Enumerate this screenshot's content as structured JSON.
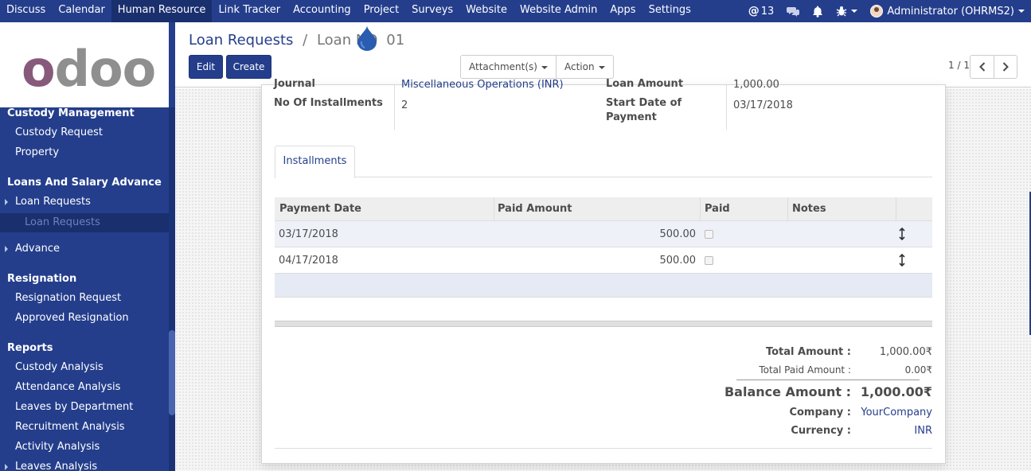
{
  "topbar": {
    "menu": [
      "Discuss",
      "Calendar",
      "Human Resource",
      "Link Tracker",
      "Accounting",
      "Project",
      "Surveys",
      "Website",
      "Website Admin",
      "Apps",
      "Settings"
    ],
    "active_menu": "Human Resource",
    "mentions_count": "13",
    "user_name": "Administrator (OHRMS2)"
  },
  "sidebar": {
    "logo_text": "odoo",
    "custody_header": "Custody Management",
    "custody_request": "Custody Request",
    "property": "Property",
    "loans_header": "Loans And Salary Advance",
    "loan_requests": "Loan Requests",
    "loan_requests_sub": "Loan Requests",
    "advance": "Advance",
    "resignation_header": "Resignation",
    "resignation_request": "Resignation Request",
    "approved_resignation": "Approved Resignation",
    "reports_header": "Reports",
    "custody_analysis": "Custody Analysis",
    "attendance_analysis": "Attendance Analysis",
    "leaves_by_department": "Leaves by Department",
    "recruitment_analysis": "Recruitment Analysis",
    "activity_analysis": "Activity Analysis",
    "leaves_analysis": "Leaves Analysis"
  },
  "control_panel": {
    "breadcrumb_parent": "Loan Requests",
    "breadcrumb_sep": "/",
    "breadcrumb_current": "Loan NO   01",
    "edit_label": "Edit",
    "create_label": "Create",
    "attachments_label": "Attachment(s)",
    "action_label": "Action",
    "pager": "1 / 1"
  },
  "form": {
    "journal_label": "Journal",
    "journal_value": "Miscellaneous Operations (INR)",
    "loan_amount_label": "Loan Amount",
    "loan_amount_value": "1,000.00",
    "installments_label": "No Of Installments",
    "installments_value": "2",
    "start_date_label": "Start Date of Payment",
    "start_date_value": "03/17/2018"
  },
  "tabs": {
    "installments": "Installments"
  },
  "table": {
    "columns": [
      "Payment Date",
      "Paid Amount",
      "Paid",
      "Notes"
    ],
    "rows": [
      {
        "payment_date": "03/17/2018",
        "paid_amount": "500.00",
        "paid": false,
        "notes": ""
      },
      {
        "payment_date": "04/17/2018",
        "paid_amount": "500.00",
        "paid": false,
        "notes": ""
      }
    ]
  },
  "totals": {
    "total_amount_label": "Total Amount :",
    "total_amount_value": "1,000.00₹",
    "total_paid_label": "Total Paid Amount :",
    "total_paid_value": "0.00₹",
    "balance_label": "Balance Amount :",
    "balance_value": "1,000.00₹",
    "company_label": "Company :",
    "company_value": "YourCompany",
    "currency_label": "Currency :",
    "currency_value": "INR"
  },
  "colors": {
    "brand": "#243e8c",
    "odoo_purple": "#875a7b",
    "odoo_grey": "#8f8f8f"
  }
}
